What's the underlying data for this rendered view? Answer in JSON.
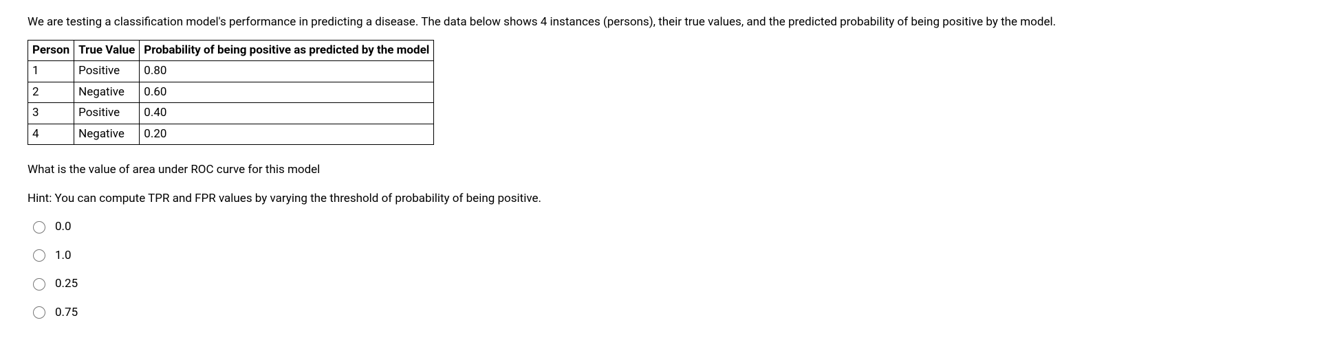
{
  "question_text": "We are testing a classification model's performance in predicting a disease. The data below shows 4 instances (persons), their true values, and the predicted probability of being positive by the model.",
  "table": {
    "headers": {
      "col1": "Person",
      "col2": "True Value",
      "col3": "Probability of being positive as predicted by the model"
    },
    "rows": [
      {
        "person": "1",
        "true_value": "Positive",
        "probability": "0.80"
      },
      {
        "person": "2",
        "true_value": "Negative",
        "probability": "0.60"
      },
      {
        "person": "3",
        "true_value": "Positive",
        "probability": "0.40"
      },
      {
        "person": "4",
        "true_value": "Negative",
        "probability": "0.20"
      }
    ]
  },
  "prompt": "What is the value of area under ROC curve for this model",
  "hint": "Hint: You can compute TPR and FPR values by varying the threshold of probability of being positive.",
  "options": [
    {
      "label": "0.0"
    },
    {
      "label": "1.0"
    },
    {
      "label": "0.25"
    },
    {
      "label": "0.75"
    }
  ]
}
